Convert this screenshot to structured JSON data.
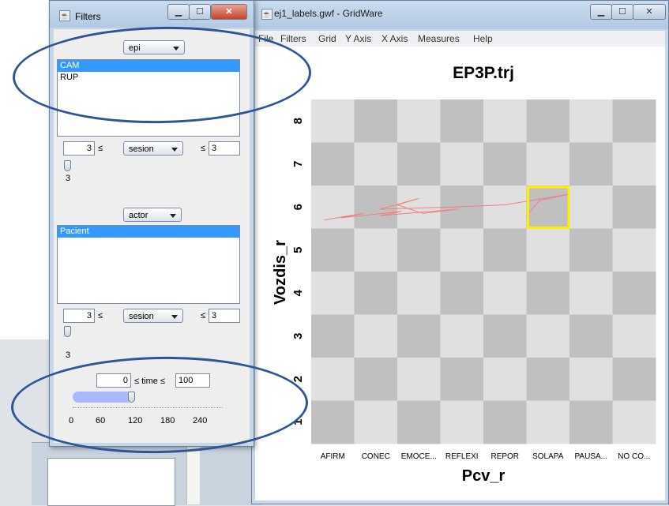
{
  "gridware": {
    "title": "ej1_labels.gwf - GridWare",
    "menu": [
      "File",
      "Filters",
      "Grid",
      "Y Axis",
      "X Axis",
      "Measures",
      "Help"
    ]
  },
  "filters": {
    "title": "Filters",
    "epi": {
      "label": "epi",
      "items": [
        "CAM",
        "RUP"
      ],
      "selected_index": 0
    },
    "session1": {
      "min": "3",
      "label": "sesion",
      "max": "3",
      "leq": "≤",
      "slider_value": "3"
    },
    "actor": {
      "label": "actor",
      "items": [
        "Pacient"
      ],
      "selected_index": 0
    },
    "session2": {
      "min": "3",
      "label": "sesion",
      "max": "3",
      "leq": "≤",
      "slider_value": "3"
    },
    "time": {
      "min": "0",
      "label": "≤ time ≤",
      "max": "100",
      "fill_fraction": 0.4,
      "ticks": [
        "0",
        "60",
        "120",
        "180",
        "240"
      ]
    }
  },
  "chart_data": {
    "type": "line",
    "title": "EP3P.trj",
    "xlabel": "Pcv_r",
    "ylabel": "Vozdis_r",
    "x_categories": [
      "AFIRM",
      "CONEC",
      "EMOCE...",
      "REFLEXI",
      "REPOR",
      "SOLAPA",
      "PAUSA...",
      "NO CO..."
    ],
    "y_ticks": [
      "1",
      "2",
      "3",
      "4",
      "5",
      "6",
      "7",
      "8"
    ],
    "grid": "checkerboard",
    "colors": {
      "dark_cell": "#c0c0c0",
      "light_cell": "#e0e0e0",
      "trajectory": "#f08080",
      "highlight": "#ffee00"
    },
    "trajectory": [
      [
        0.3,
        5.7
      ],
      [
        1.2,
        5.85
      ],
      [
        0.7,
        5.75
      ],
      [
        2.1,
        5.9
      ],
      [
        1.6,
        5.8
      ],
      [
        3.4,
        5.95
      ],
      [
        2.6,
        5.85
      ],
      [
        2.0,
        6.05
      ],
      [
        2.5,
        6.2
      ],
      [
        1.6,
        5.95
      ],
      [
        3.3,
        6.0
      ],
      [
        4.5,
        6.05
      ],
      [
        6.0,
        6.3
      ],
      [
        5.3,
        6.15
      ],
      [
        5.0,
        5.8
      ]
    ],
    "highlight_cell": {
      "x": "SOLAPA",
      "y": "6"
    }
  }
}
